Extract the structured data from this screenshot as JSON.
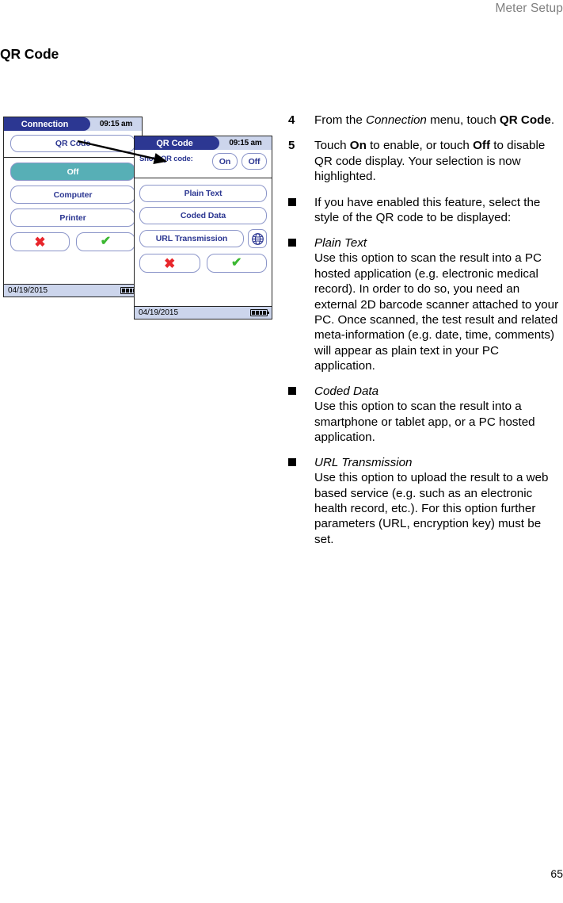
{
  "running_head": "Meter Setup",
  "chapter_title": "QR Code",
  "page_number": "65",
  "colors": {
    "titlebar_navy": "#2c3792",
    "titlebar_light": "#ccd5ec",
    "button_text_blue": "#2c3792",
    "selected_teal": "#57afb6",
    "cancel_red": "#e8262b",
    "confirm_green": "#3cb832"
  },
  "figure": {
    "screen1": {
      "title": "Connection",
      "time": "09:15 am",
      "header_button": "QR Code",
      "options": [
        {
          "label": "Off",
          "selected": true
        },
        {
          "label": "Computer",
          "selected": false
        },
        {
          "label": "Printer",
          "selected": false
        }
      ],
      "cancel_icon": "cross-icon",
      "confirm_icon": "check-icon",
      "cancel_glyph": "✖",
      "confirm_glyph": "✔",
      "date": "04/19/2015",
      "battery_icon": "battery-full-icon"
    },
    "screen2": {
      "title": "QR Code",
      "time": "09:15 am",
      "show_label": "Show QR code:",
      "toggle": [
        {
          "label": "On",
          "selected": false
        },
        {
          "label": "Off",
          "selected": false
        }
      ],
      "options": [
        {
          "label": "Plain Text"
        },
        {
          "label": "Coded Data"
        },
        {
          "label": "URL Transmission"
        }
      ],
      "globe_icon": "globe-icon",
      "cancel_glyph": "✖",
      "confirm_glyph": "✔",
      "date": "04/19/2015",
      "battery_icon": "battery-full-icon"
    },
    "callout_arrow": "arrow-from-qr-code-button-to-qr-code-screen"
  },
  "instructions": {
    "steps": [
      {
        "number": "4",
        "segments": [
          {
            "text": "From the ",
            "style": "normal"
          },
          {
            "text": "Connection",
            "style": "italic"
          },
          {
            "text": " menu, touch ",
            "style": "normal"
          },
          {
            "text": "QR Code",
            "style": "bold"
          },
          {
            "text": ".",
            "style": "normal"
          }
        ]
      },
      {
        "number": "5",
        "segments": [
          {
            "text": "Touch ",
            "style": "normal"
          },
          {
            "text": "On",
            "style": "bold"
          },
          {
            "text": " to enable, or touch ",
            "style": "normal"
          },
          {
            "text": "Off",
            "style": "bold"
          },
          {
            "text": " to disable QR code display. Your selection is now highlighted.",
            "style": "normal"
          }
        ]
      }
    ],
    "bullets": [
      {
        "heading": "",
        "body": "If you have enabled this feature, select the style of the QR code to be displayed:"
      },
      {
        "heading": "Plain Text",
        "body": "Use this option to scan the result into a PC hosted application (e.g. electronic medical record). In order to do so, you need an external 2D barcode scanner attached to your PC. Once scanned, the test result and related meta-information (e.g. date, time, comments) will appear as plain text in your PC application."
      },
      {
        "heading": "Coded Data",
        "body": "Use this option to scan the result into a smartphone or tablet app, or a PC hosted application."
      },
      {
        "heading": "URL Transmission",
        "body": "Use this option to upload the result to a web based service (e.g. such as an electronic health record, etc.). For this option further parameters (URL, encryption key) must be set."
      }
    ]
  }
}
